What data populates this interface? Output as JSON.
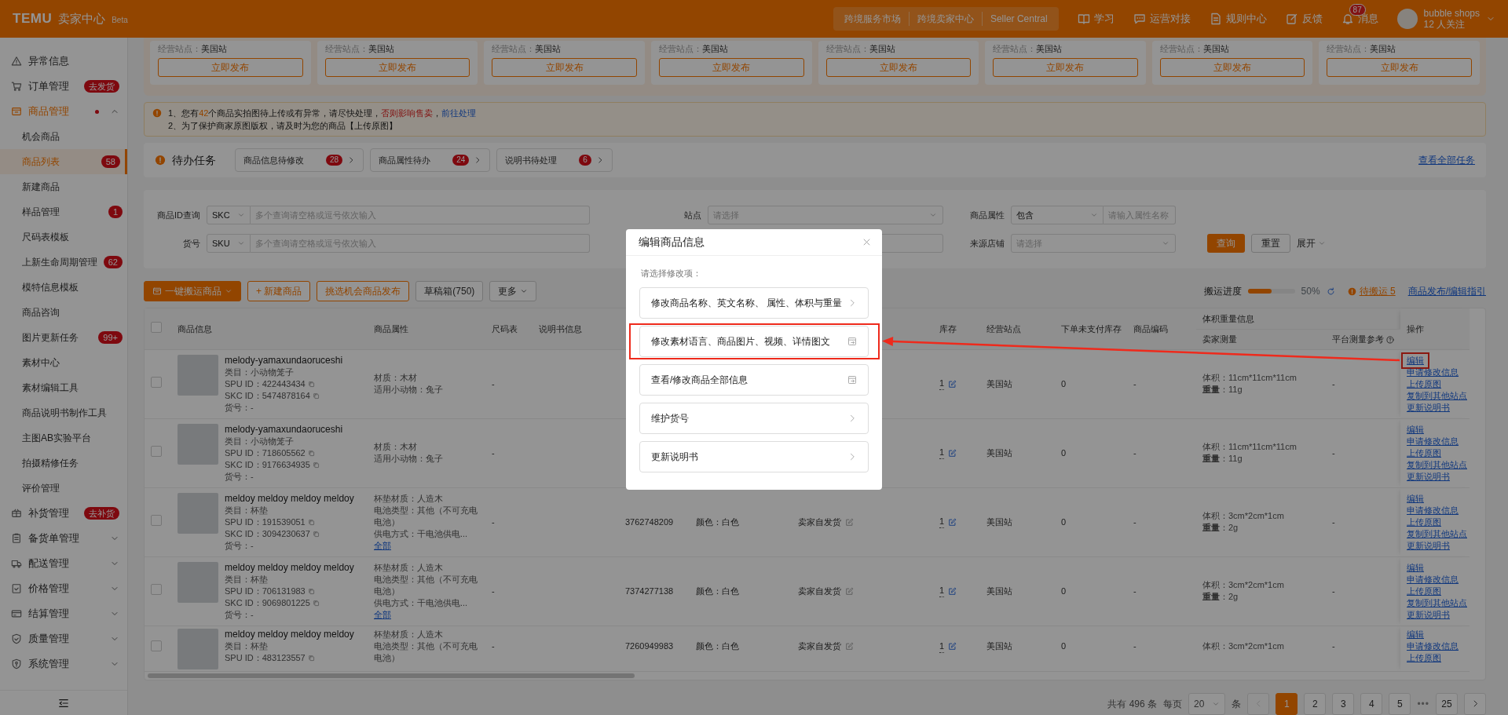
{
  "header": {
    "logo": "TEMU",
    "app_name": "卖家中心",
    "beta": "Beta",
    "portal_links": [
      "跨境服务市场",
      "跨境卖家中心",
      "Seller Central"
    ],
    "tools": [
      "学习",
      "运营对接",
      "规则中心",
      "反馈",
      "消息"
    ],
    "message_count": "87",
    "user": {
      "name": "bubble shops",
      "followers": "12 人关注"
    }
  },
  "sidebar": {
    "items": [
      {
        "label": "异常信息",
        "selected": false
      },
      {
        "label": "订单管理",
        "tag": "去发货",
        "selected": false
      },
      {
        "label": "商品管理",
        "dot": true,
        "expanded": true,
        "selected": false,
        "children": [
          {
            "label": "机会商品",
            "selected": false
          },
          {
            "label": "商品列表",
            "badge": "58",
            "selected": true
          },
          {
            "label": "新建商品",
            "selected": false
          },
          {
            "label": "样品管理",
            "badge": "1",
            "selected": false
          },
          {
            "label": "尺码表模板",
            "selected": false
          },
          {
            "label": "上新生命周期管理",
            "badge": "62",
            "selected": false
          },
          {
            "label": "模特信息模板",
            "selected": false
          },
          {
            "label": "商品咨询",
            "selected": false
          },
          {
            "label": "图片更新任务",
            "badge": "99+",
            "selected": false
          },
          {
            "label": "素材中心",
            "selected": false
          },
          {
            "label": "素材编辑工具",
            "selected": false
          },
          {
            "label": "商品说明书制作工具",
            "selected": false
          },
          {
            "label": "主图AB实验平台",
            "selected": false
          },
          {
            "label": "拍摄精修任务",
            "selected": false
          },
          {
            "label": "评价管理",
            "selected": false
          }
        ]
      },
      {
        "label": "补货管理",
        "tag": "去补货",
        "selected": false
      },
      {
        "label": "备货单管理",
        "expanded": false,
        "selected": false
      },
      {
        "label": "配送管理",
        "expanded": false,
        "selected": false
      },
      {
        "label": "价格管理",
        "expanded": false,
        "selected": false
      },
      {
        "label": "结算管理",
        "expanded": false,
        "selected": false
      },
      {
        "label": "质量管理",
        "expanded": false,
        "selected": false
      },
      {
        "label": "系统管理",
        "expanded": false,
        "selected": false
      }
    ]
  },
  "publish_cards": [
    {
      "site_label": "经营站点：",
      "site": "美国站",
      "button": "立即发布"
    },
    {
      "site_label": "经营站点：",
      "site": "美国站",
      "button": "立即发布"
    },
    {
      "site_label": "经营站点：",
      "site": "美国站",
      "button": "立即发布"
    },
    {
      "site_label": "经营站点：",
      "site": "美国站",
      "button": "立即发布"
    },
    {
      "site_label": "经营站点：",
      "site": "美国站",
      "button": "立即发布"
    },
    {
      "site_label": "经营站点：",
      "site": "美国站",
      "button": "立即发布"
    },
    {
      "site_label": "经营站点：",
      "site": "美国站",
      "button": "立即发布"
    },
    {
      "site_label": "经营站点：",
      "site": "美国站",
      "button": "立即发布"
    }
  ],
  "notices": [
    [
      {
        "text": "1、您有",
        "kind": "plain"
      },
      {
        "text": "42",
        "kind": "count"
      },
      {
        "text": "个商品实拍图待上传或有异常，请尽快处理，",
        "kind": "plain"
      },
      {
        "text": "否则影响售卖",
        "kind": "warning"
      },
      {
        "text": "，",
        "kind": "plain"
      },
      {
        "text": "前往处理",
        "kind": "link"
      }
    ],
    [
      {
        "text": "2、为了保护商家原图版权，请及时为您的商品【上传原图】",
        "kind": "plain"
      }
    ]
  ],
  "todo": {
    "title": "待办任务",
    "items": [
      {
        "label": "商品信息待修改",
        "count": "28"
      },
      {
        "label": "商品属性待办",
        "count": "24"
      },
      {
        "label": "说明书待处理",
        "count": "6"
      }
    ],
    "view_all": "查看全部任务"
  },
  "filters": {
    "fields": [
      {
        "kind": "select-input",
        "label": "商品ID查询",
        "select": "SKC",
        "placeholder": "多个查询请空格或逗号依次输入"
      },
      {
        "kind": "select",
        "label": "站点",
        "placeholder": "请选择"
      },
      {
        "kind": "select-input",
        "label": "商品属性",
        "select": "包含",
        "placeholder": "请输入属性名称"
      },
      {
        "kind": "select-input",
        "label": "货号",
        "select": "SKU",
        "placeholder": "多个查询请空格或逗号依次输入"
      },
      {
        "kind": "blank"
      },
      {
        "kind": "select",
        "label": "来源店铺",
        "placeholder": "请选择"
      }
    ],
    "search": "查询",
    "reset": "重置",
    "expand": "展开"
  },
  "toolbar": {
    "buttons": [
      {
        "label": "一键搬运商品",
        "kind": "solid",
        "menu": true
      },
      {
        "label": "+ 新建商品",
        "kind": "outline",
        "menu": false
      },
      {
        "label": "挑选机会商品发布",
        "kind": "outline",
        "menu": false
      },
      {
        "label": "草稿箱(750)",
        "kind": "plain",
        "menu": false
      },
      {
        "label": "更多",
        "kind": "plain",
        "menu": true
      }
    ],
    "progress": {
      "label": "搬运进度",
      "level": 0.5,
      "reading": "50%"
    },
    "pending": "待搬运 5",
    "guide": "商品发布/编辑指引"
  },
  "table": {
    "all_checked": false,
    "columns": [
      "商品信息",
      "商品属性",
      "尺码表",
      "说明书信息",
      "库存",
      "经营站点",
      "下单未支付库存",
      "商品编码"
    ],
    "group_column": {
      "label": "体积重量信息",
      "sub": [
        "卖家测量",
        "平台测量参考"
      ]
    },
    "action_column": "操作",
    "rows": [
      {
        "checked": false,
        "title": "melody-yamaxundaoruceshi",
        "category": "类目：小动物笼子",
        "spu": "SPU ID：422443434",
        "skc": "SKC ID：5474878164",
        "item_no": "货号：-",
        "attributes": [
          "材质：木材",
          "适用小动物：兔子"
        ],
        "size_chart": "-",
        "stock": "1",
        "site": "美国站",
        "unpaid": "0",
        "code": "-",
        "volume": "体积：11cm*11cm*11cm",
        "weight": "**重量**：11g",
        "platform": "-",
        "actions": [
          {
            "label": "编辑",
            "highlighted": true
          },
          {
            "label": "申请修改信息",
            "highlighted": false
          },
          {
            "label": "上传原图",
            "highlighted": false
          },
          {
            "label": "复制到其他站点",
            "highlighted": false
          },
          {
            "label": "更新说明书",
            "highlighted": false
          }
        ]
      },
      {
        "checked": false,
        "title": "melody-yamaxundaoruceshi",
        "category": "类目：小动物笼子",
        "spu": "SPU ID：718605562",
        "skc": "SKC ID：9176634935",
        "item_no": "货号：-",
        "attributes": [
          "材质：木材",
          "适用小动物：兔子"
        ],
        "size_chart": "-",
        "stock": "1",
        "site": "美国站",
        "unpaid": "0",
        "code": "-",
        "volume": "体积：11cm*11cm*11cm",
        "weight": "**重量**：11g",
        "platform": "-",
        "actions": [
          {
            "label": "编辑",
            "highlighted": false
          },
          {
            "label": "申请修改信息",
            "highlighted": false
          },
          {
            "label": "上传原图",
            "highlighted": false
          },
          {
            "label": "复制到其他站点",
            "highlighted": false
          },
          {
            "label": "更新说明书",
            "highlighted": false
          }
        ]
      },
      {
        "checked": false,
        "title": "meldoy meldoy meldoy meldoy",
        "category": "类目：杯垫",
        "spu": "SPU ID：191539051",
        "skc": "SKC ID：3094230637",
        "item_no": "货号：-",
        "attributes": [
          "杯垫材质：人造木",
          "电池类型：其他（不可充电电池）",
          "供电方式：干电池供电..."
        ],
        "more_link": "全部",
        "size_chart": "-",
        "sku_id": "3762748209",
        "spec": "颜色：白色",
        "shipping": "卖家自发货",
        "stock": "1",
        "site": "美国站",
        "unpaid": "0",
        "code": "-",
        "volume": "体积：3cm*2cm*1cm",
        "weight": "**重量**：2g",
        "platform": "-",
        "actions": [
          {
            "label": "编辑",
            "highlighted": false
          },
          {
            "label": "申请修改信息",
            "highlighted": false
          },
          {
            "label": "上传原图",
            "highlighted": false
          },
          {
            "label": "复制到其他站点",
            "highlighted": false
          },
          {
            "label": "更新说明书",
            "highlighted": false
          }
        ]
      },
      {
        "checked": false,
        "title": "meldoy meldoy meldoy meldoy",
        "category": "类目：杯垫",
        "spu": "SPU ID：706131983",
        "skc": "SKC ID：9069801225",
        "item_no": "货号：-",
        "attributes": [
          "杯垫材质：人造木",
          "电池类型：其他（不可充电电池）",
          "供电方式：干电池供电..."
        ],
        "more_link": "全部",
        "size_chart": "-",
        "sku_id": "7374277138",
        "spec": "颜色：白色",
        "shipping": "卖家自发货",
        "stock": "1",
        "site": "美国站",
        "unpaid": "0",
        "code": "-",
        "volume": "体积：3cm*2cm*1cm",
        "weight": "**重量**：2g",
        "platform": "-",
        "actions": [
          {
            "label": "编辑",
            "highlighted": false
          },
          {
            "label": "申请修改信息",
            "highlighted": false
          },
          {
            "label": "上传原图",
            "highlighted": false
          },
          {
            "label": "复制到其他站点",
            "highlighted": false
          },
          {
            "label": "更新说明书",
            "highlighted": false
          }
        ]
      },
      {
        "checked": false,
        "title": "meldoy meldoy meldoy meldoy",
        "category": "类目：杯垫",
        "spu": "SPU ID：483123557",
        "attributes": [
          "杯垫材质：人造木",
          "电池类型：其他（不可充电电池）"
        ],
        "size_chart": "-",
        "sku_id": "7260949983",
        "spec": "颜色：白色",
        "shipping": "卖家自发货",
        "stock": "1",
        "site": "美国站",
        "unpaid": "0",
        "code": "-",
        "volume": "体积：3cm*2cm*1cm",
        "platform": "-",
        "actions": [
          {
            "label": "编辑",
            "highlighted": false
          },
          {
            "label": "申请修改信息",
            "highlighted": false
          },
          {
            "label": "上传原图",
            "highlighted": false
          }
        ]
      }
    ]
  },
  "pagination": {
    "total": "共有 496 条",
    "per_page_label": "每页",
    "per_page": "20",
    "unit": "条",
    "prev": {
      "disabled": true
    },
    "next": {
      "disabled": false
    },
    "pages": [
      {
        "label": "1",
        "kind": "page",
        "selected": true
      },
      {
        "label": "2",
        "kind": "page",
        "selected": false
      },
      {
        "label": "3",
        "kind": "page",
        "selected": false
      },
      {
        "label": "4",
        "kind": "page",
        "selected": false
      },
      {
        "label": "5",
        "kind": "page",
        "selected": false
      },
      {
        "label": "•••",
        "kind": "ellipsis",
        "selected": false
      },
      {
        "label": "25",
        "kind": "page",
        "selected": false
      }
    ]
  },
  "modal": {
    "title": "编辑商品信息",
    "prompt": "请选择修改项：",
    "options": [
      {
        "label": "修改商品名称、英文名称、 属性、体积与重量",
        "kind": "chevron",
        "highlighted": false
      },
      {
        "label": "修改素材语言、商品图片、视频、详情图文",
        "kind": "external",
        "highlighted": true
      },
      {
        "label": "查看/修改商品全部信息",
        "kind": "external",
        "highlighted": false
      },
      {
        "label": "维护货号",
        "kind": "chevron",
        "highlighted": false
      },
      {
        "label": "更新说明书",
        "kind": "chevron",
        "highlighted": false
      }
    ]
  }
}
